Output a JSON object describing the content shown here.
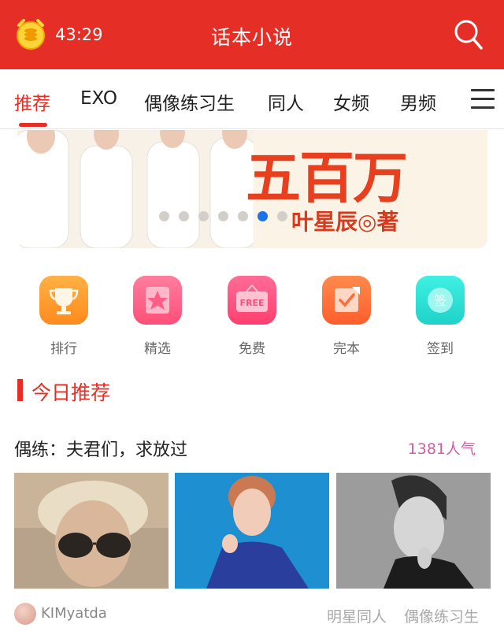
{
  "appbar": {
    "timer": "43:29",
    "title": "话本小说"
  },
  "tabs": [
    {
      "label": "推荐",
      "active": true
    },
    {
      "label": "EXO"
    },
    {
      "label": "偶像练习生"
    },
    {
      "label": "同人"
    },
    {
      "label": "女频"
    },
    {
      "label": "男频"
    }
  ],
  "banner": {
    "title": "五百万",
    "author": "叶星辰◎著",
    "dots_total": 7,
    "dots_active_index": 5
  },
  "quick": [
    {
      "label": "排行",
      "icon": "trophy-icon"
    },
    {
      "label": "精选",
      "icon": "star-icon"
    },
    {
      "label": "免费",
      "icon": "free-tag-icon",
      "badge": "FREE"
    },
    {
      "label": "完本",
      "icon": "checkbox-icon"
    },
    {
      "label": "签到",
      "icon": "sign-in-icon",
      "badge": "签"
    }
  ],
  "section": {
    "title": "今日推荐"
  },
  "book": {
    "title": "偶练：夫君们，求放过",
    "popularity": "1381人气",
    "author": "KIMyatda",
    "tags": [
      "明星同人",
      "偶像练习生"
    ]
  },
  "colors": {
    "brand": "#e52f26",
    "popularity": "#d85aa0"
  }
}
